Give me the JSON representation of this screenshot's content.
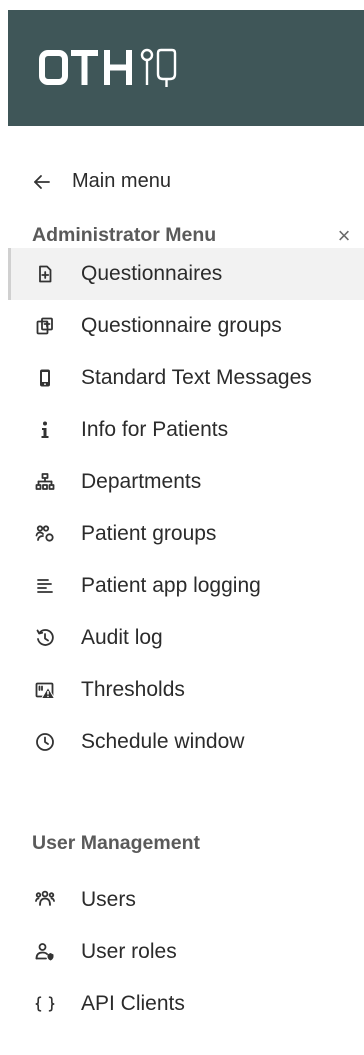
{
  "brand": {
    "logo_text": "OTH"
  },
  "nav": {
    "back_label": "Main menu",
    "close_symbol": "×"
  },
  "admin": {
    "title": "Administrator Menu",
    "items": [
      {
        "label": "Questionnaires",
        "icon": "file-plus-icon",
        "active": true
      },
      {
        "label": "Questionnaire groups",
        "icon": "copy-plus-icon"
      },
      {
        "label": "Standard Text Messages",
        "icon": "phone-icon"
      },
      {
        "label": "Info for Patients",
        "icon": "info-icon"
      },
      {
        "label": "Departments",
        "icon": "sitemap-icon"
      },
      {
        "label": "Patient groups",
        "icon": "people-group-icon"
      },
      {
        "label": "Patient app logging",
        "icon": "align-left-icon"
      },
      {
        "label": "Audit log",
        "icon": "history-icon"
      },
      {
        "label": "Thresholds",
        "icon": "warning-card-icon"
      },
      {
        "label": "Schedule window",
        "icon": "clock-icon"
      }
    ]
  },
  "user_mgmt": {
    "title": "User Management",
    "items": [
      {
        "label": "Users",
        "icon": "users-icon"
      },
      {
        "label": "User roles",
        "icon": "user-role-icon"
      },
      {
        "label": "API Clients",
        "icon": "braces-icon"
      }
    ]
  },
  "colors": {
    "brand_bg": "#3f5658",
    "text": "#2b2b2b",
    "section_text": "#5a5a5a",
    "active_bg": "#f2f2f2"
  }
}
